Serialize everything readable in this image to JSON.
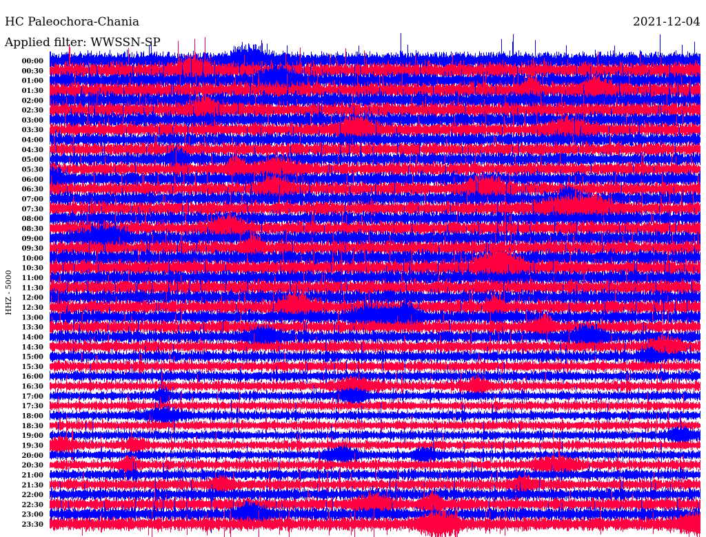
{
  "chart_data": {
    "type": "line",
    "subtype": "helicorder",
    "title": "HC Paleochora-Chania",
    "date": "2021-12-04",
    "filter_text": "Applied filter: WWSSN-SP",
    "ylabel": "HHZ - 5000",
    "row_labels": [
      "00:00",
      "00:30",
      "01:00",
      "01:30",
      "02:00",
      "02:30",
      "03:00",
      "03:30",
      "04:00",
      "04:30",
      "05:00",
      "05:30",
      "06:00",
      "06:30",
      "07:00",
      "07:30",
      "08:00",
      "08:30",
      "09:00",
      "09:30",
      "10:00",
      "10:30",
      "11:00",
      "11:30",
      "12:00",
      "12:30",
      "13:00",
      "13:30",
      "14:00",
      "14:30",
      "15:00",
      "15:30",
      "16:00",
      "16:30",
      "17:00",
      "17:30",
      "18:00",
      "18:30",
      "19:00",
      "19:30",
      "20:00",
      "20:30",
      "21:00",
      "21:30",
      "22:00",
      "22:30",
      "23:00",
      "23:30"
    ],
    "relative_amplitude": [
      1.3,
      1.3,
      1.25,
      1.25,
      1.25,
      1.2,
      1.15,
      1.1,
      1.05,
      1.05,
      1.05,
      1.05,
      1.1,
      1.1,
      1.1,
      1.1,
      1.1,
      1.1,
      1.15,
      1.15,
      1.2,
      1.2,
      1.15,
      1.15,
      1.15,
      1.1,
      1.05,
      1.0,
      0.95,
      0.9,
      0.85,
      0.8,
      0.8,
      0.75,
      0.7,
      0.7,
      0.7,
      0.7,
      0.7,
      0.7,
      0.7,
      0.75,
      0.8,
      0.85,
      0.9,
      0.95,
      1.0,
      1.05
    ],
    "colors": [
      "#0000ff",
      "#ff0040"
    ]
  }
}
